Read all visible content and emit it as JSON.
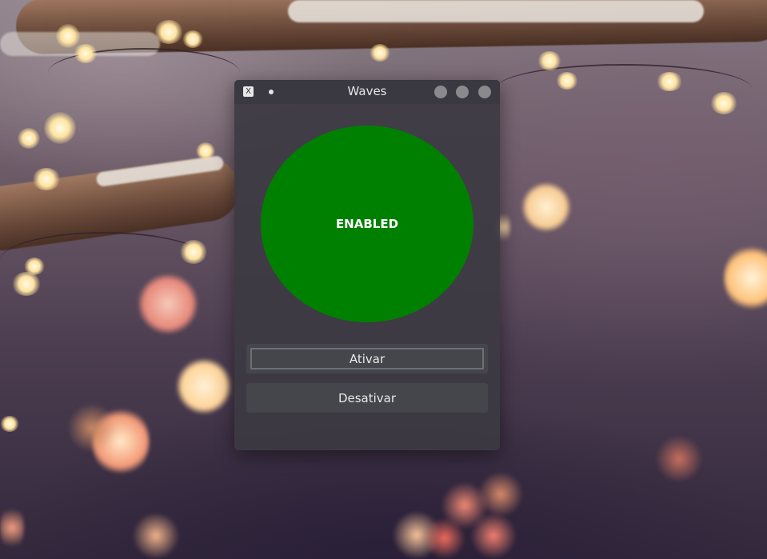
{
  "window": {
    "title": "Waves",
    "app_icon_glyph": "X"
  },
  "status": {
    "text": "ENABLED",
    "color": "#008000"
  },
  "buttons": {
    "activate_label": "Ativar",
    "deactivate_label": "Desativar"
  },
  "icons": {
    "app_icon": "x-app-icon",
    "pin": "pin-dot-icon",
    "minimize": "minimize-icon",
    "maximize": "maximize-icon",
    "close": "close-icon"
  }
}
